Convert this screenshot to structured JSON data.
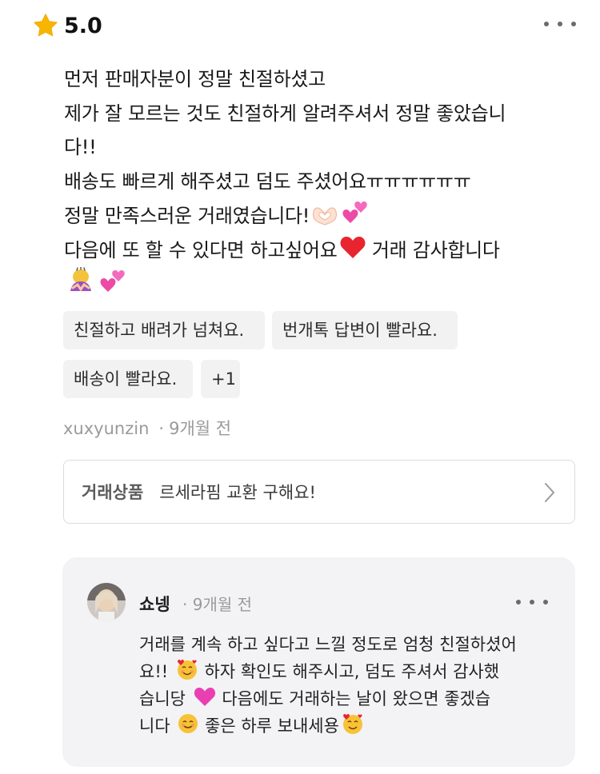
{
  "review": {
    "rating": "5.0",
    "icons": {
      "star": "star-icon",
      "more": "more-icon"
    },
    "accent_star_color": "#f7b500",
    "body_lines": [
      "먼저 판매자분이 정말 친절하셨고",
      "제가 잘 모르는 것도 친절하게 알려주셔서 정말 좋았습니",
      "다!!",
      "배송도 빠르게 해주셨고 덤도 주셨어요ㅠㅠㅠㅠㅠㅠ",
      "정말 만족스러운 거래였습니다!",
      "다음에 또 할 수 있다면 하고싶어요",
      " 거래 감사합니다"
    ],
    "tags": [
      "친절하고 배려가 넘쳐요.",
      "번개톡 답변이 빨라요.",
      "배송이 빨라요.",
      "+1"
    ],
    "author": "xuxyunzin",
    "meta_separator": "·",
    "time_ago": "9개월 전"
  },
  "product": {
    "label": "거래상품",
    "title": "르세라핌 교환 구해요!",
    "icon": "chevron-right-icon"
  },
  "reply": {
    "name": "쇼넹",
    "separator": "·",
    "time_ago": "9개월 전",
    "lines": [
      "거래를 계속 하고 싶다고 느낄 정도로 엄청 친절하셨어",
      "요!!",
      "하자 확인도 해주시고, 덤도 주셔서 감사했",
      "습니당",
      "다음에도 거래하는 날이 왔으면 좋겠습",
      "니다",
      "좋은 하루 보내세용"
    ]
  }
}
